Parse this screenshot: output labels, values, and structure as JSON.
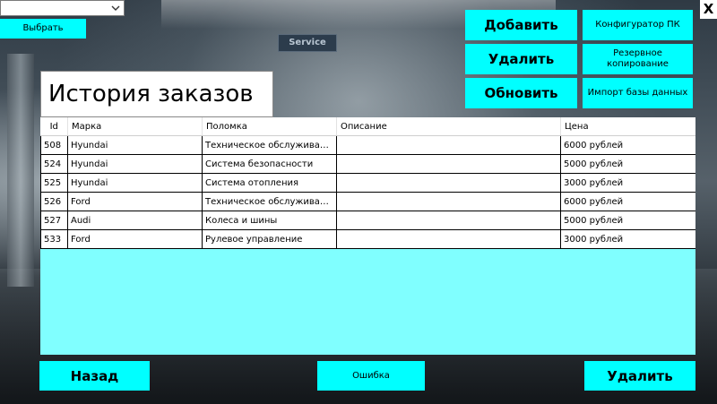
{
  "toolbar": {
    "combo_value": "",
    "select_label": "Выбрать",
    "close_label": "X"
  },
  "actions": {
    "add_label": "Добавить",
    "delete_label": "Удалить",
    "refresh_label": "Обновить",
    "configurator_label": "Конфигуратор ПК",
    "backup_label": "Резервное копирование",
    "import_label": "Импорт базы данных"
  },
  "page": {
    "title": "История заказов"
  },
  "table": {
    "columns": [
      "Id",
      "Марка",
      "Поломка",
      "Описание",
      "Цена"
    ],
    "rows": [
      {
        "id": "508",
        "brand": "Hyundai",
        "issue": "Техническое обслуживан...",
        "description": "",
        "price": "6000 рублей"
      },
      {
        "id": "524",
        "brand": "Hyundai",
        "issue": "Система безопасности",
        "description": "",
        "price": "5000 рублей"
      },
      {
        "id": "525",
        "brand": "Hyundai",
        "issue": "Система отопления",
        "description": "",
        "price": "3000 рублей"
      },
      {
        "id": "526",
        "brand": "Ford",
        "issue": "Техническое обслуживан...",
        "description": "",
        "price": "6000 рублей"
      },
      {
        "id": "527",
        "brand": "Audi",
        "issue": "Колеса и шины",
        "description": "",
        "price": "5000 рублей"
      },
      {
        "id": "533",
        "brand": "Ford",
        "issue": "Рулевое управление",
        "description": "",
        "price": "3000 рублей"
      }
    ]
  },
  "footer": {
    "back_label": "Назад",
    "error_label": "Ошибка",
    "delete_label": "Удалить"
  },
  "background": {
    "sign_text": "Service"
  },
  "colors": {
    "accent": "#00ffff",
    "grid_background": "#80ffff"
  }
}
